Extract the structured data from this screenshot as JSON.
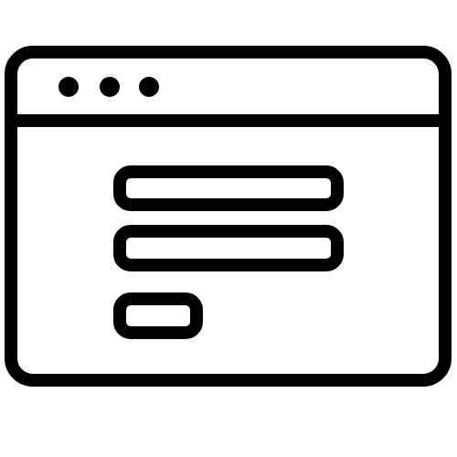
{
  "icon": {
    "name": "browser-window-form-icon",
    "stroke_color": "#000000",
    "fill_color": "#ffffff",
    "title_bar": {
      "dots": [
        "dot",
        "dot",
        "dot"
      ]
    },
    "content": {
      "fields": [
        "field",
        "field"
      ],
      "button": "button"
    }
  }
}
